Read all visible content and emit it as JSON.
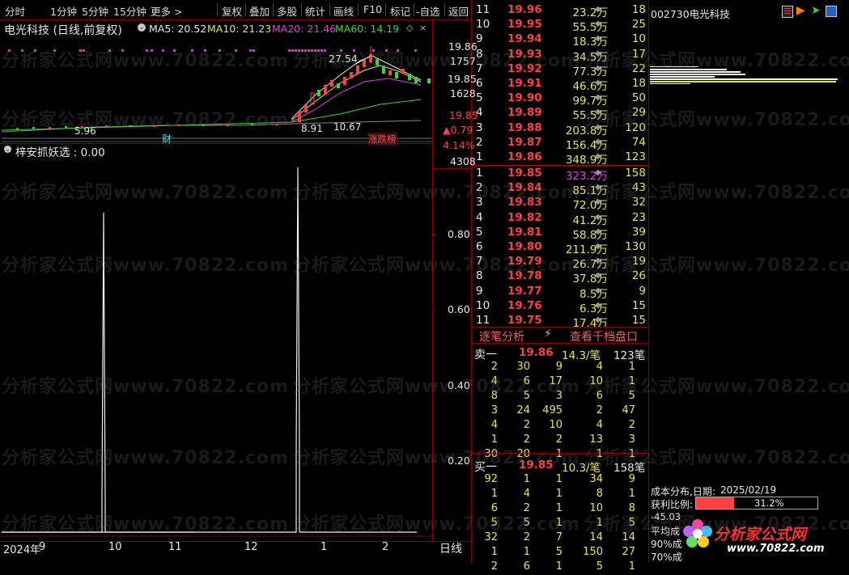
{
  "toolbar": {
    "items": [
      "分时",
      "1分钟",
      "5分钟",
      "15分钟",
      "更多 >",
      "复权",
      "叠加",
      "多股",
      "统计",
      "画线",
      "F10",
      "标记",
      "-自选",
      "返回"
    ]
  },
  "chart": {
    "title": "电光科技 (日线,前复权)",
    "ma5_label": "MA5: 20.52",
    "ma10_label": "MA10: 21.23",
    "ma20_label": "MA20: 21.46",
    "ma60_label": "MA60: 14.19",
    "price_high_mark": "27.54",
    "price_low_mark_1": "5.96",
    "price_low_mark_2": "8.91",
    "price_mid_mark": "10.67",
    "event_label_cai": "财",
    "event_label_zdb": "涨跌榜",
    "axis_top_price": "19.86",
    "axis_top_vol": "1757",
    "axis_mid_price": "19.85",
    "axis_mid_vol": "1628",
    "axis_last_price": "19.85",
    "axis_change": "▲0.79",
    "axis_change_pct": "4.14%",
    "axis_volume": "4308"
  },
  "indicator": {
    "title": "梓安抓妖选 : 0.00",
    "yticks": [
      "0.80",
      "0.60",
      "0.40",
      "0.20"
    ],
    "yvalues": [
      0.8,
      0.6,
      0.4,
      0.2
    ],
    "spikes": [
      {
        "month": "10",
        "value": 0.88
      },
      {
        "month": "1",
        "value": 1.0
      }
    ]
  },
  "xaxis": {
    "labels": [
      "2024年",
      "9",
      "10",
      "11",
      "12",
      "1",
      "2"
    ],
    "period_button": "日线"
  },
  "ask_book": [
    {
      "level": "11",
      "price": "19.96",
      "vol": "23.2万",
      "count": "18"
    },
    {
      "level": "10",
      "price": "19.95",
      "vol": "55.5万",
      "count": "25"
    },
    {
      "level": "9",
      "price": "19.94",
      "vol": "18.3万",
      "count": "10"
    },
    {
      "level": "8",
      "price": "19.93",
      "vol": "34.5万",
      "count": "17"
    },
    {
      "level": "7",
      "price": "19.92",
      "vol": "77.3万",
      "count": "22"
    },
    {
      "level": "6",
      "price": "19.91",
      "vol": "46.6万",
      "count": "18"
    },
    {
      "level": "5",
      "price": "19.90",
      "vol": "99.7万",
      "count": "50"
    },
    {
      "level": "4",
      "price": "19.89",
      "vol": "55.5万",
      "count": "29"
    },
    {
      "level": "3",
      "price": "19.88",
      "vol": "203.8万",
      "count": "120"
    },
    {
      "level": "2",
      "price": "19.87",
      "vol": "156.4万",
      "count": "74"
    },
    {
      "level": "1",
      "price": "19.86",
      "vol": "348.9万",
      "count": "123"
    }
  ],
  "bid_book": [
    {
      "level": "1",
      "price": "19.85",
      "vol": "323.2万",
      "count": "158"
    },
    {
      "level": "2",
      "price": "19.84",
      "vol": "85.1万",
      "count": "43"
    },
    {
      "level": "3",
      "price": "19.83",
      "vol": "72.0万",
      "count": "32"
    },
    {
      "level": "4",
      "price": "19.82",
      "vol": "41.2万",
      "count": "23"
    },
    {
      "level": "5",
      "price": "19.81",
      "vol": "58.8万",
      "count": "39"
    },
    {
      "level": "6",
      "price": "19.80",
      "vol": "211.9万",
      "count": "130"
    },
    {
      "level": "7",
      "price": "19.79",
      "vol": "26.7万",
      "count": "19"
    },
    {
      "level": "8",
      "price": "19.78",
      "vol": "37.8万",
      "count": "26"
    },
    {
      "level": "9",
      "price": "19.77",
      "vol": "8.5万",
      "count": "9"
    },
    {
      "level": "10",
      "price": "19.76",
      "vol": "6.3万",
      "count": "15"
    },
    {
      "level": "11",
      "price": "19.75",
      "vol": "17.4万",
      "count": "15"
    }
  ],
  "tick_tabs": {
    "left": "逐笔分析",
    "right": "查看千档盘口"
  },
  "sell_one": {
    "label": "卖一",
    "price": "19.86",
    "vol": "14.3/笔",
    "count": "123笔"
  },
  "sell_ticks": [
    [
      "2",
      "30",
      "9",
      "4",
      "1"
    ],
    [
      "4",
      "6",
      "17",
      "10",
      "1"
    ],
    [
      "8",
      "5",
      "3",
      "6",
      "5"
    ],
    [
      "3",
      "24",
      "495",
      "2",
      "47"
    ],
    [
      "4",
      "2",
      "10",
      "4",
      "2"
    ],
    [
      "1",
      "2",
      "2",
      "13",
      "3"
    ],
    [
      "30",
      "20",
      "1",
      "1",
      "1"
    ]
  ],
  "buy_one": {
    "label": "买一",
    "price": "19.85",
    "vol": "10.3/笔",
    "count": "158笔"
  },
  "buy_ticks": [
    [
      "92",
      "1",
      "1",
      "34",
      "9"
    ],
    [
      "1",
      "4",
      "1",
      "8",
      "1"
    ],
    [
      "6",
      "2",
      "1",
      "10",
      "8"
    ],
    [
      "5",
      "5",
      "1",
      "1",
      "5"
    ],
    [
      "32",
      "2",
      "7",
      "14",
      "14"
    ],
    [
      "1",
      "1",
      "5",
      "150",
      "27"
    ],
    [
      "2",
      "6",
      "1",
      "5",
      "1"
    ]
  ],
  "right_panel": {
    "stock_code_name": "002730电光科技",
    "cost_dist_label": "成本分布,日期:",
    "cost_dist_date": "2025/02/19",
    "profit_ratio_label": "获利比例:",
    "profit_ratio_value": "31.2%",
    "profit_ratio_fraction": 0.312,
    "profit_line": "-45.03",
    "avg_cost_label": "平均成",
    "pct90_label": "90%成",
    "pct70_label": "70%成"
  },
  "logo": {
    "name": "分析家公式网",
    "url": "www.70822.com"
  },
  "watermark_text": "分析家公式网www.70822.com",
  "colors": {
    "up": "#ff4040",
    "down": "#35d735",
    "frame": "#8b0000",
    "volume": "#e6e65a",
    "ma20": "#e040e0",
    "ma60": "#35d735"
  }
}
